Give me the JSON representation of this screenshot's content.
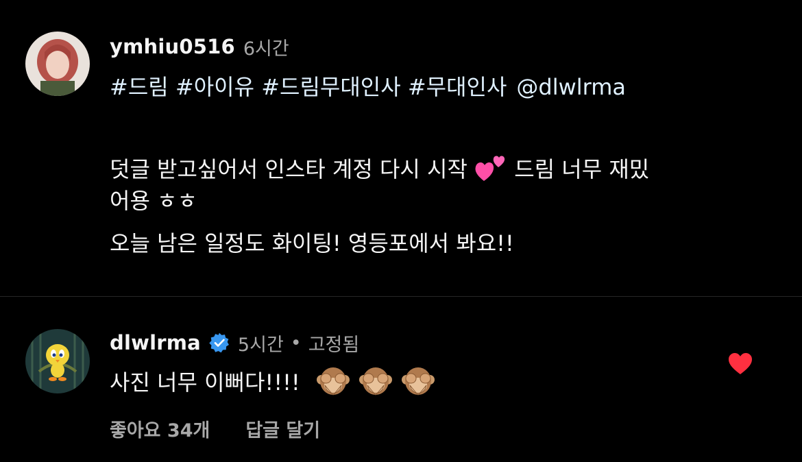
{
  "caption": {
    "username": "ymhiu0516",
    "time": "6시간",
    "hashtags": [
      "#드림",
      "#아이유",
      "#드림무대인사",
      "#무대인사"
    ],
    "mention": "@dlwlrma",
    "body_line1": "덧글 받고싶어서 인스타 계정 다시 시작",
    "body_line1_end": "드림 너무 재밌",
    "body_line2": "어용 ㅎㅎ",
    "body_line3": "오늘 남은 일정도 화이팅! 영등포에서 봐요!!",
    "emoji": "two-hearts"
  },
  "comment": {
    "username": "dlwlrma",
    "time": "5시간",
    "separator": "•",
    "pinned": "고정됨",
    "text": "사진 너무 이뻐다!!!!",
    "emojis": [
      "see-no-evil-monkey",
      "see-no-evil-monkey",
      "see-no-evil-monkey"
    ],
    "likes_label": "좋아요 34개",
    "reply_label": "답글 달기",
    "liked": true
  },
  "colors": {
    "background": "#000000",
    "text": "#f5f5f5",
    "secondary": "#a8a8a8",
    "link": "#e0f1ff",
    "verified": "#3897f0",
    "heart": "#ff3040"
  }
}
